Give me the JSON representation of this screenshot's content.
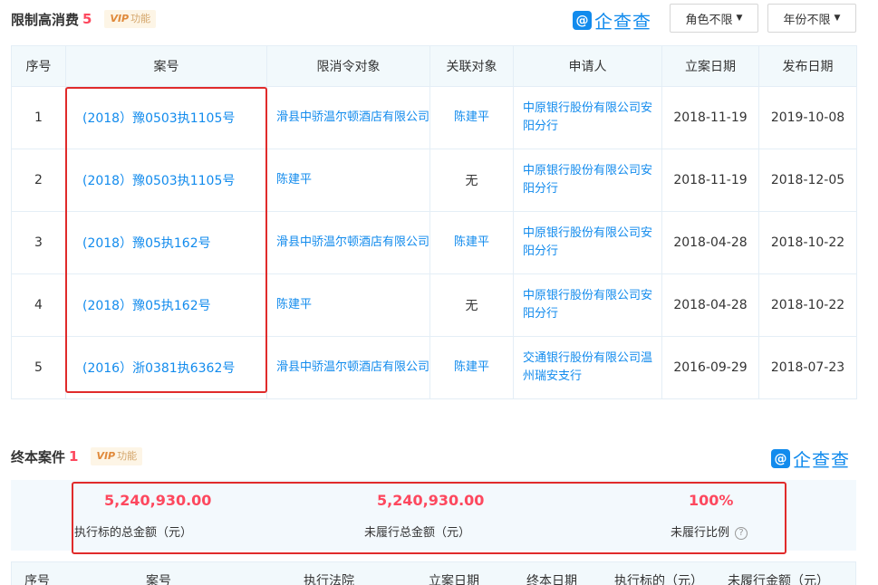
{
  "section1": {
    "title": "限制高消费",
    "count": "5",
    "vip_prefix": "VIP",
    "vip_label": "功能",
    "logo_text": "企查查",
    "filters": [
      "角色不限",
      "年份不限"
    ],
    "columns": [
      "序号",
      "案号",
      "限消令对象",
      "关联对象",
      "申请人",
      "立案日期",
      "发布日期"
    ],
    "rows": [
      {
        "no": "1",
        "case": "(2018）豫0503执1105号",
        "target": "滑县中骄温尔顿酒店有限公司",
        "related": "陈建平",
        "applicant": "中原银行股份有限公司安阳分行",
        "filed": "2018-11-19",
        "published": "2019-10-08"
      },
      {
        "no": "2",
        "case": "(2018）豫0503执1105号",
        "target": "陈建平",
        "related": "无",
        "applicant": "中原银行股份有限公司安阳分行",
        "filed": "2018-11-19",
        "published": "2018-12-05"
      },
      {
        "no": "3",
        "case": "(2018）豫05执162号",
        "target": "滑县中骄温尔顿酒店有限公司",
        "related": "陈建平",
        "applicant": "中原银行股份有限公司安阳分行",
        "filed": "2018-04-28",
        "published": "2018-10-22"
      },
      {
        "no": "4",
        "case": "(2018）豫05执162号",
        "target": "陈建平",
        "related": "无",
        "applicant": "中原银行股份有限公司安阳分行",
        "filed": "2018-04-28",
        "published": "2018-10-22"
      },
      {
        "no": "5",
        "case": "(2016）浙0381执6362号",
        "target": "滑县中骄温尔顿酒店有限公司",
        "related": "陈建平",
        "applicant": "交通银行股份有限公司温州瑞安支行",
        "filed": "2016-09-29",
        "published": "2018-07-23"
      }
    ]
  },
  "section2": {
    "title": "终本案件",
    "count": "1",
    "vip_prefix": "VIP",
    "vip_label": "功能",
    "logo_text": "企查查",
    "summary": [
      {
        "value": "5,240,930.00",
        "label": "执行标的总金额（元）"
      },
      {
        "value": "5,240,930.00",
        "label": "未履行总金额（元）"
      },
      {
        "value": "100%",
        "label": "未履行比例"
      }
    ],
    "columns": [
      "序号",
      "案号",
      "执行法院",
      "立案日期",
      "终本日期",
      "执行标的（元）",
      "未履行金额（元）"
    ]
  }
}
